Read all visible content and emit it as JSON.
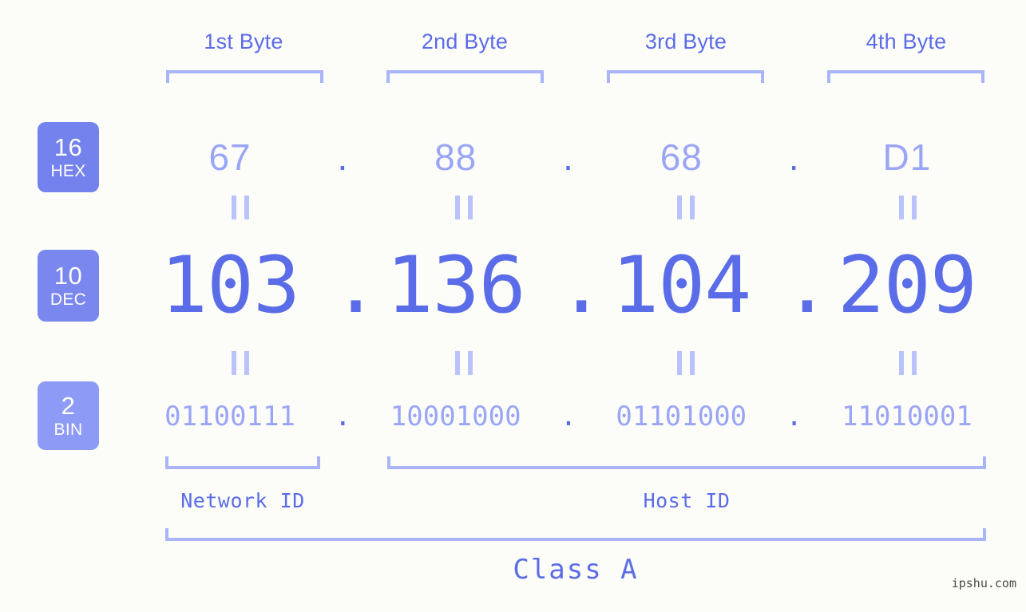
{
  "page": {
    "background_color": "#fcfdf9",
    "accent_color": "#5b6ce8",
    "accent_light_color": "#9aa5f5",
    "bracket_color": "#aab4f8",
    "watermark": "ipshu.com"
  },
  "byte_headers": [
    {
      "label": "1st Byte"
    },
    {
      "label": "2nd Byte"
    },
    {
      "label": "3rd Byte"
    },
    {
      "label": "4th Byte"
    }
  ],
  "bases": [
    {
      "number": "16",
      "name": "HEX",
      "color": "#7482ee"
    },
    {
      "number": "10",
      "name": "DEC",
      "color": "#7a87ef"
    },
    {
      "number": "2",
      "name": "BIN",
      "color": "#8e9bf6"
    }
  ],
  "separator": ".",
  "rows": {
    "hex": {
      "bytes": [
        "67",
        "88",
        "68",
        "D1"
      ]
    },
    "dec": {
      "bytes": [
        "103",
        "136",
        "104",
        "209"
      ]
    },
    "bin": {
      "bytes": [
        "01100111",
        "10001000",
        "01101000",
        "11010001"
      ]
    }
  },
  "equals_mark": "||",
  "segments": {
    "network_id": "Network ID",
    "host_id": "Host ID",
    "class": "Class A"
  }
}
